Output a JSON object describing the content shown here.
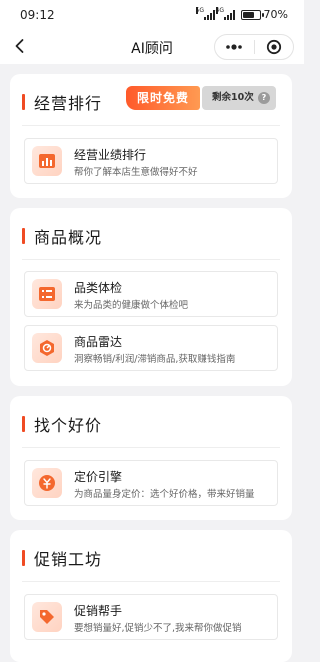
{
  "status_bar": {
    "time": "09:12",
    "net1": "5G",
    "net2": "4G",
    "battery": "70%",
    "battery_level": 0.7
  },
  "nav": {
    "title": "AI顾问",
    "back_icon": "back-arrow-icon",
    "more_icon": "more-dots-icon",
    "close_icon": "target-circle-icon"
  },
  "sections": [
    {
      "title": "经营排行",
      "free_badge": "限时免费",
      "remaining": "剩余10次",
      "help": "?",
      "items": [
        {
          "title": "经营业绩排行",
          "subtitle": "帮你了解本店生意做得好不好",
          "icon": "bar-chart-icon"
        }
      ]
    },
    {
      "title": "商品概况",
      "items": [
        {
          "title": "品类体检",
          "subtitle": "来为品类的健康做个体检吧",
          "icon": "category-list-icon"
        },
        {
          "title": "商品雷达",
          "subtitle": "洞察畅销/利润/滞销商品,获取赚钱指南",
          "icon": "radar-icon"
        }
      ]
    },
    {
      "title": "找个好价",
      "items": [
        {
          "title": "定价引擎",
          "subtitle": "为商品量身定价：选个好价格，带来好销量",
          "icon": "price-coin-icon"
        }
      ]
    },
    {
      "title": "促销工坊",
      "items": [
        {
          "title": "促销帮手",
          "subtitle": "要想销量好,促销少不了,我来帮你做促销",
          "icon": "promo-tag-icon"
        }
      ]
    }
  ],
  "colors": {
    "accent": "#f04b23",
    "free_badge_start": "#ff5a2a",
    "free_badge_end": "#ff9a52",
    "remain_badge": "#d7d7d7"
  }
}
